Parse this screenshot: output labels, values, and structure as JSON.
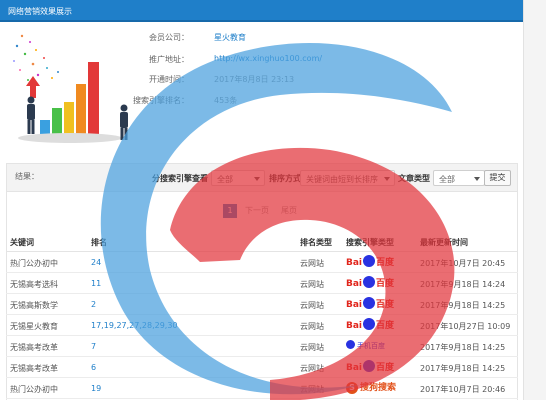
{
  "header": {
    "title": "网络营销效果展示"
  },
  "info": {
    "member_label": "会员公司：",
    "member_value": "星火教育",
    "url_label": "推广地址：",
    "url_value": "http://wx.xinghuo100.com/",
    "open_label": "开通时间：",
    "open_value": "2017年8月8日 23:13",
    "engine_label": "搜索引擎排名：",
    "engine_value": "453条"
  },
  "filters": {
    "result_label": "结果：",
    "engine_label": "分搜索引擎查看",
    "engine_value": "全部",
    "sort_label": "排序方式",
    "sort_value": "关键词由短到长排序",
    "doc_label": "文章类型",
    "doc_value": "全部",
    "submit_label": "提交"
  },
  "pager": {
    "current": "1",
    "next": "下一页",
    "last": "尾页"
  },
  "table": {
    "headers": {
      "keyword": "关键词",
      "rank": "排名",
      "type": "排名类型",
      "engine": "搜索引擎类型",
      "updated": "最新更新时间"
    },
    "rows": [
      {
        "keyword": "热门公办初中",
        "rank": "24",
        "type": "云网站",
        "engine": "baidu",
        "engine_text_a": "Bai",
        "engine_text_b": "百度",
        "updated": "2017年10月7日 20:45"
      },
      {
        "keyword": "无锡高考选科",
        "rank": "11",
        "type": "云网站",
        "engine": "baidu",
        "engine_text_a": "Bai",
        "engine_text_b": "百度",
        "updated": "2017年9月18日 14:24"
      },
      {
        "keyword": "无锡高斯数学",
        "rank": "2",
        "type": "云网站",
        "engine": "baidu",
        "engine_text_a": "Bai",
        "engine_text_b": "百度",
        "updated": "2017年9月18日 14:25"
      },
      {
        "keyword": "无锡星火教育",
        "rank": "17,19,27,27,28,29,30",
        "type": "云网站",
        "engine": "baidu",
        "engine_text_a": "Bai",
        "engine_text_b": "百度",
        "updated": "2017年10月27日 10:09"
      },
      {
        "keyword": "无锡高考改革",
        "rank": "7",
        "type": "云网站",
        "engine": "mbaidu",
        "engine_text_a": "手机百度",
        "engine_text_b": "",
        "updated": "2017年9月18日 14:25"
      },
      {
        "keyword": "无锡高考改革",
        "rank": "6",
        "type": "云网站",
        "engine": "baidu",
        "engine_text_a": "Bai",
        "engine_text_b": "百度",
        "updated": "2017年9月18日 14:25"
      },
      {
        "keyword": "热门公办初中",
        "rank": "19",
        "type": "云网站",
        "engine": "sogou",
        "engine_text_a": "S",
        "engine_text_b": "搜狗搜索",
        "updated": "2017年10月7日 20:46"
      }
    ]
  },
  "colors": {
    "brand_blue": "#1f7fc9",
    "watermark_blue": "#4a9fde",
    "watermark_red": "#e2353c"
  }
}
